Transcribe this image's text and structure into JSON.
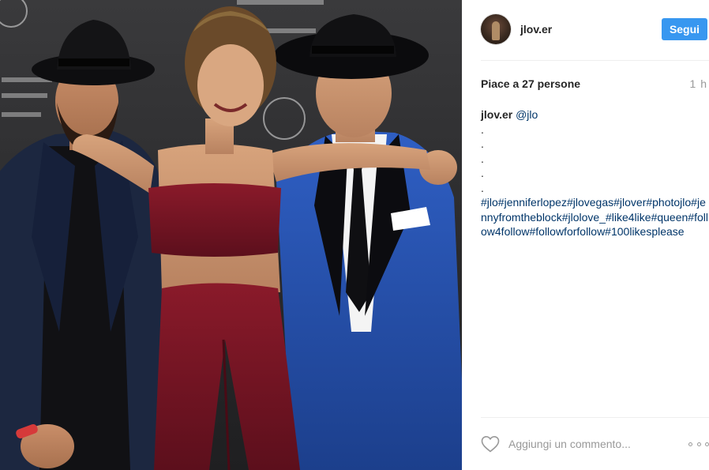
{
  "post": {
    "image_alt": "Foto di jlov.er"
  },
  "header": {
    "username": "jlov.er",
    "follow_label": "Segui"
  },
  "meta": {
    "likes_text": "Piace a 27 persone",
    "time_ago": "1 h"
  },
  "caption": {
    "user": "jlov.er",
    "mention": "@jlo",
    "dots": [
      ".",
      ".",
      ".",
      ".",
      "."
    ],
    "hashtags": "#jlo#jenniferlopez#jlovegas#jlover#photojlo#jennyfromtheblock#jlolove_#like4like#queen#follow4follow#followforfollow#100likesplease"
  },
  "comment": {
    "placeholder": "Aggiungi un commento..."
  },
  "colors": {
    "accent": "#3897f0",
    "hashtag": "#003569",
    "muted": "#999999"
  },
  "icons": {
    "like": "heart-outline-icon",
    "options": "more-options-icon"
  }
}
